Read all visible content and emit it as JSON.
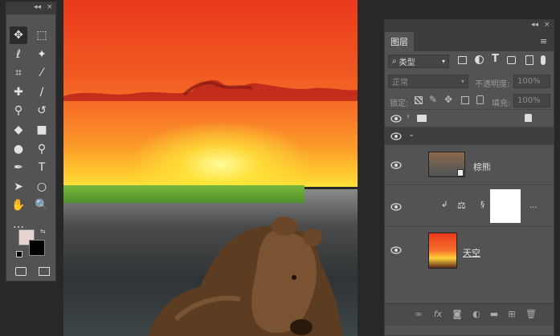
{
  "toolbar": {
    "collapse_glyph": "◂◂",
    "close_glyph": "×",
    "tools": [
      {
        "name": "move-tool",
        "glyph": "✥"
      },
      {
        "name": "marquee-tool",
        "glyph": "⬚"
      },
      {
        "name": "lasso-tool",
        "glyph": "ℓ"
      },
      {
        "name": "magic-wand-tool",
        "glyph": "✦"
      },
      {
        "name": "crop-tool",
        "glyph": "⌗"
      },
      {
        "name": "eyedropper-tool",
        "glyph": "⁄"
      },
      {
        "name": "healing-brush-tool",
        "glyph": "✚"
      },
      {
        "name": "brush-tool",
        "glyph": "∕"
      },
      {
        "name": "clone-stamp-tool",
        "glyph": "⚲"
      },
      {
        "name": "history-brush-tool",
        "glyph": "↺"
      },
      {
        "name": "eraser-tool",
        "glyph": "◆"
      },
      {
        "name": "gradient-tool",
        "glyph": "■"
      },
      {
        "name": "blur-tool",
        "glyph": "●"
      },
      {
        "name": "dodge-tool",
        "glyph": "⚲"
      },
      {
        "name": "pen-tool",
        "glyph": "✒"
      },
      {
        "name": "type-tool",
        "glyph": "T"
      },
      {
        "name": "path-selection-tool",
        "glyph": "➤"
      },
      {
        "name": "ellipse-tool",
        "glyph": "○"
      },
      {
        "name": "hand-tool",
        "glyph": "✋"
      },
      {
        "name": "zoom-tool",
        "glyph": "🔍"
      },
      {
        "name": "more-tools",
        "glyph": "…"
      }
    ],
    "foreground_color": "#e8d3d3",
    "background_color": "#000000"
  },
  "layers_panel": {
    "tab_label": "图层",
    "filter_kind": "类型",
    "blend_mode": "正常",
    "opacity_label": "不透明度:",
    "opacity_value": "100%",
    "lock_label": "锁定:",
    "fill_label": "填充:",
    "fill_value": "100%",
    "layers": [
      {
        "name": "",
        "type": "group-collapsed"
      },
      {
        "name": "",
        "type": "group-expanded"
      },
      {
        "name": "棕熊",
        "type": "smart-object"
      },
      {
        "name": "",
        "type": "adjustment"
      },
      {
        "name": "天空",
        "type": "image"
      }
    ],
    "ellipsis": "..."
  },
  "colors": {
    "panel_bg": "#535353",
    "panel_dark": "#3c3c3c",
    "app_bg": "#282828"
  }
}
